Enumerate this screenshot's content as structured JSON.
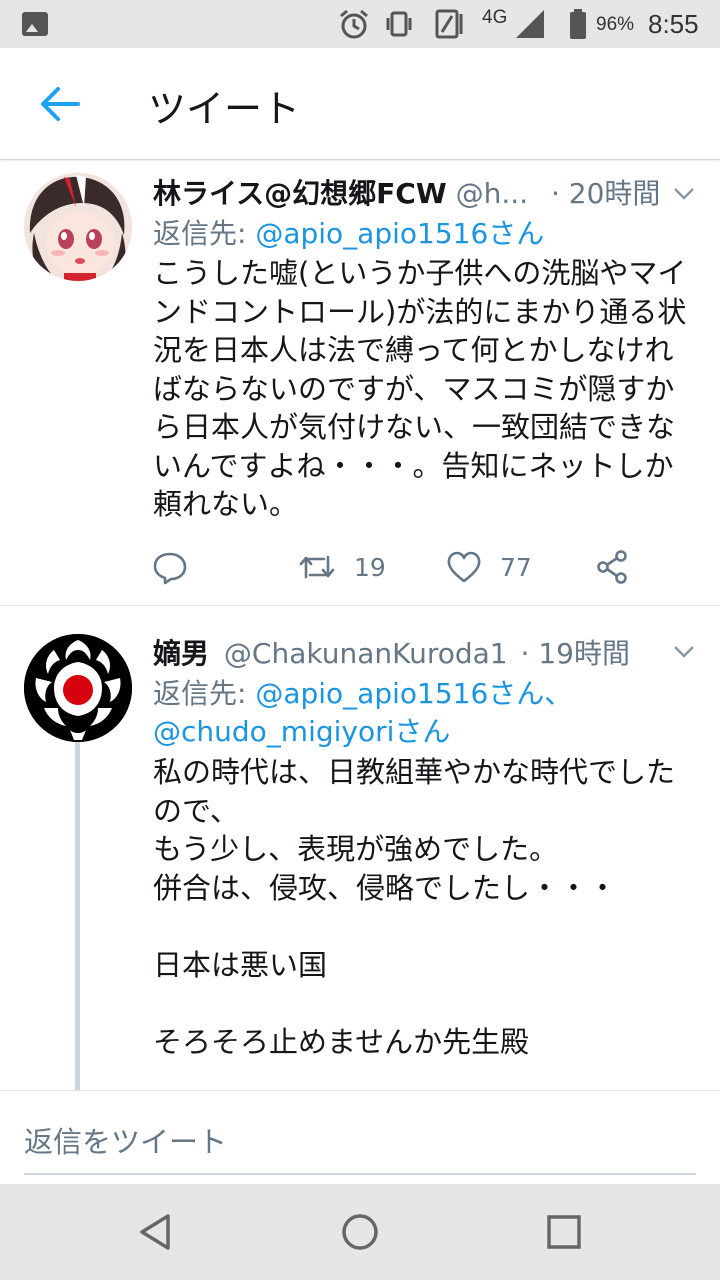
{
  "status_bar": {
    "network": "4G",
    "battery": "96%",
    "time": "8:55"
  },
  "app_bar": {
    "title": "ツイート"
  },
  "tweets": [
    {
      "name": "林ライス@幻想郷FCW",
      "handle": "@h...",
      "time": "· 20時間",
      "reply_prefix": "返信先: ",
      "reply_to": "@apio_apio1516さん",
      "body": "こうした嘘(というか子供への洗脳やマインドコントロール)が法的にまかり通る状況を日本人は法で縛って何とかしなければならないのですが、マスコミが隠すから日本人が気付けない、一致団結できないんですよね・・・。告知にネットしか頼れない。",
      "retweets": "19",
      "likes": "77"
    },
    {
      "name": "嫡男",
      "handle": "@ChakunanKuroda1",
      "time": "· 19時間",
      "reply_prefix": "返信先: ",
      "reply_to_1": "@apio_apio1516さん、",
      "reply_to_2": "@chudo_migiyoriさん",
      "body": "私の時代は、日教組華やかな時代でしたので、\nもう少し、表現が強めでした。\n併合は、侵攻、侵略でしたし・・・\n\n日本は悪い国\n\nそろそろ止めませんか先生殿"
    }
  ],
  "reply_bar": {
    "placeholder": "返信をツイート"
  },
  "colors": {
    "accent": "#1da1f2",
    "mention": "#1b95e0",
    "secondary_text": "#657786",
    "primary_text": "#14171a"
  }
}
